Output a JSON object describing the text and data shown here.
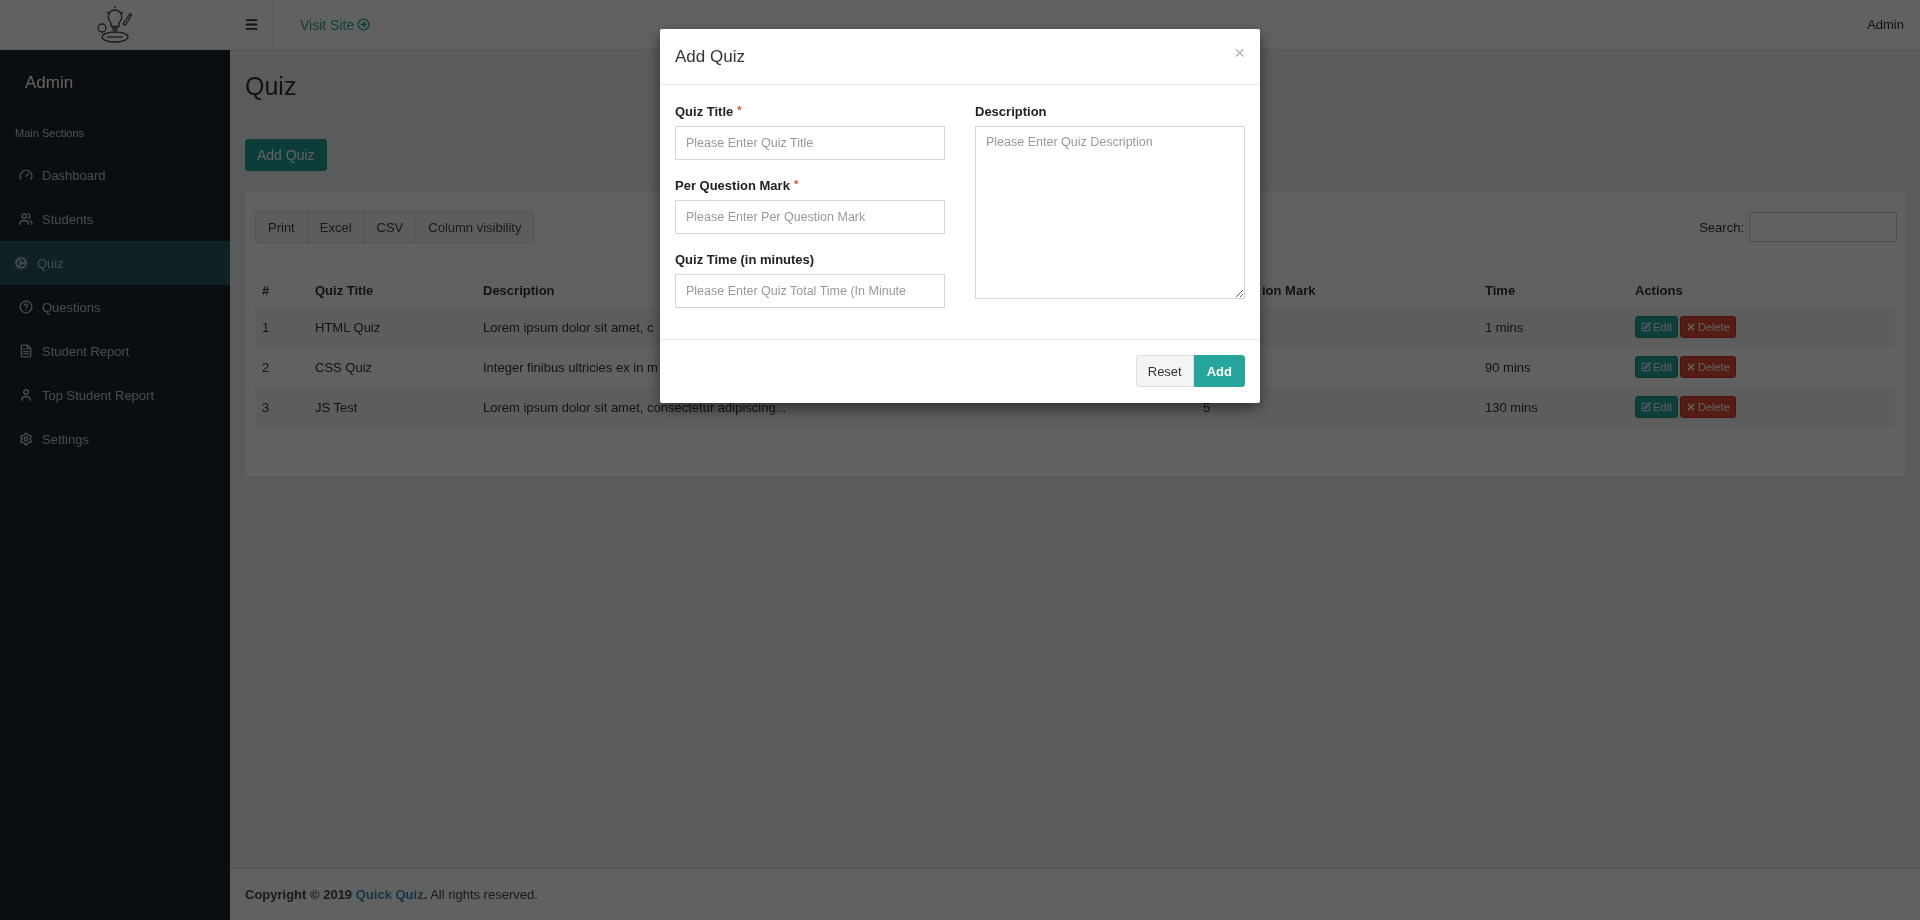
{
  "header": {
    "visit_link": "Visit Site",
    "user": "Admin"
  },
  "sidebar": {
    "title": "Admin",
    "section": "Main Sections",
    "items": [
      {
        "label": "Dashboard",
        "selected": false
      },
      {
        "label": "Students",
        "selected": false
      },
      {
        "label": "Quiz",
        "selected": true
      },
      {
        "label": "Questions",
        "selected": false
      },
      {
        "label": "Student Report",
        "selected": false
      },
      {
        "label": "Top Student Report",
        "selected": false
      },
      {
        "label": "Settings",
        "selected": false
      }
    ]
  },
  "page": {
    "title": "Quiz",
    "add_button": "Add Quiz"
  },
  "table_card": {
    "export_buttons": [
      "Print",
      "Excel",
      "CSV",
      "Column visibility"
    ],
    "search_label": "Search:",
    "columns": [
      "#",
      "Quiz Title",
      "Description",
      "ion Mark",
      "Time",
      "Actions"
    ],
    "rows": [
      {
        "number": "1",
        "title": "HTML Quiz",
        "description": "Lorem ipsum dolor sit amet, c",
        "time": "1 mins",
        "actions": [
          "Edit",
          "Delete"
        ]
      },
      {
        "number": "2",
        "title": "CSS Quiz",
        "description": "Integer finibus ultricies ex in m",
        "time": "90 mins",
        "actions": [
          "Edit",
          "Delete"
        ]
      },
      {
        "number": "3",
        "title": "JS Test",
        "description": "Lorem ipsum dolor sit amet, consectetur adipiscing...",
        "mark": "5",
        "time": "130 mins",
        "actions": [
          "Edit",
          "Delete"
        ]
      }
    ]
  },
  "footer": {
    "prefix": "Copyright © 2019",
    "brand": "Quick Quiz",
    "suffix": "**.** All rights reserved."
  },
  "modal": {
    "title": "Add Quiz",
    "close": "×",
    "fields": [
      {
        "label": "Quiz Title",
        "required_mark": "*",
        "placeholder": "Please Enter Quiz Title"
      },
      {
        "label": "Per Question Mark",
        "required_mark": "*",
        "placeholder": "Please Enter Per Question Mark"
      },
      {
        "label": "Quiz Time (in minutes)",
        "placeholder": "Please Enter Quiz Total Time (In Minute"
      }
    ],
    "description": {
      "label": "Description",
      "placeholder": "Please Enter Quiz Description"
    },
    "buttons": [
      {
        "label": "Reset",
        "kind": "default"
      },
      {
        "label": "Add",
        "kind": "primary"
      }
    ]
  }
}
